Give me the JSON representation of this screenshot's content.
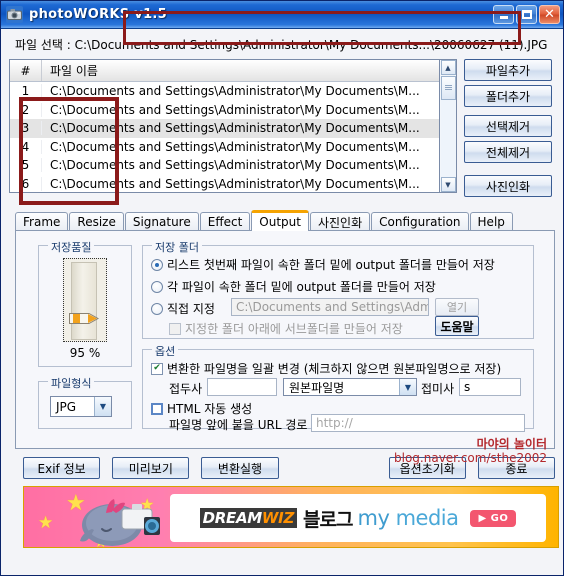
{
  "window": {
    "title": "photoWORKS v1.5",
    "icon": "camera-icon",
    "minimize_label": "",
    "maximize_label": "",
    "close_label": "✕"
  },
  "path_line": "파일 선택 : C:\\Documents and Settings\\Administrator\\My Documents...\\20060627 (11).JPG",
  "file_list": {
    "columns": [
      "#",
      "파일 이름"
    ],
    "rows": [
      {
        "num": "1",
        "name": "C:\\Documents and Settings\\Administrator\\My Documents\\M..."
      },
      {
        "num": "2",
        "name": "C:\\Documents and Settings\\Administrator\\My Documents\\M..."
      },
      {
        "num": "3",
        "name": "C:\\Documents and Settings\\Administrator\\My Documents\\M..."
      },
      {
        "num": "4",
        "name": "C:\\Documents and Settings\\Administrator\\My Documents\\M..."
      },
      {
        "num": "5",
        "name": "C:\\Documents and Settings\\Administrator\\My Documents\\M..."
      },
      {
        "num": "6",
        "name": "C:\\Documents and Settings\\Administrator\\My Documents\\M..."
      }
    ],
    "selected_row_index": 2,
    "scroll_up_glyph": "▲",
    "scroll_down_glyph": "▼"
  },
  "side_buttons": [
    {
      "label": "파일추가"
    },
    {
      "label": "폴더추가"
    },
    {
      "label": "선택제거"
    },
    {
      "label": "전체제거"
    },
    {
      "label": "사진인화"
    }
  ],
  "tabs": [
    {
      "label": "Frame",
      "active": false
    },
    {
      "label": "Resize",
      "active": false
    },
    {
      "label": "Signature",
      "active": false
    },
    {
      "label": "Effect",
      "active": false
    },
    {
      "label": "Output",
      "active": true
    },
    {
      "label": "사진인화",
      "active": false
    },
    {
      "label": "Configuration",
      "active": false
    },
    {
      "label": "Help",
      "active": false
    }
  ],
  "quality": {
    "group_title": "저장품질",
    "value_label": "95 %"
  },
  "format": {
    "group_title": "파일형식",
    "selected": "JPG",
    "arrow_glyph": "▼"
  },
  "save_folder": {
    "group_title": "저장 폴더",
    "option1": "리스트 첫번째 파일이 속한 폴더 밑에 output  폴더를 만들어 저장",
    "option2": "각 파일이 속한 폴더 밑에 output  폴더를 만들어 저장",
    "option3": "직접 지정",
    "selected_option": 1,
    "path_value": "C:\\Documents and Settings\\Administrato",
    "browse_label": "열기",
    "subfolder_checkbox": "지정한 폴더 아래에 서브폴더를 만들어 저장",
    "subfolder_checked": false,
    "help_label": "도움말"
  },
  "options": {
    "group_title": "옵션",
    "rename_checkbox": "변환한 파일명을 일괄 변경 (체크하지 않으면 원본파일명으로 저장)",
    "rename_checked": true,
    "prefix_label": "접두사",
    "prefix_value": "",
    "pattern_value": "원본파일명",
    "pattern_arrow": "▼",
    "suffix_label": "접미사",
    "suffix_value": "s",
    "html_checkbox": "HTML 자동 생성",
    "html_checked": false,
    "url_label": "파일명 앞에 붙을 URL 경로 입력",
    "url_placeholder": "http://",
    "url_value": ""
  },
  "bottom_buttons": [
    {
      "label": "Exif 정보"
    },
    {
      "label": "미리보기"
    },
    {
      "label": "변환실행"
    },
    {
      "label": "옵션초기화"
    },
    {
      "label": "종료"
    }
  ],
  "watermark": {
    "line1": "마야의 놀이터",
    "line2": "blog.naver.com/sthe2002"
  },
  "banner": {
    "brand_dream": "DREAM",
    "brand_wiz": "WIZ",
    "blog_text": "블로그",
    "my_text": "my",
    "media_text": "media",
    "go_label": "▶ GO"
  },
  "colors": {
    "titlebar_blue": "#0f55c0",
    "accent_orange": "#f5a300",
    "highlight_red": "#8b1a1a",
    "watermark_red": "#b3282d",
    "banner_pink": "#ff6fa3"
  }
}
